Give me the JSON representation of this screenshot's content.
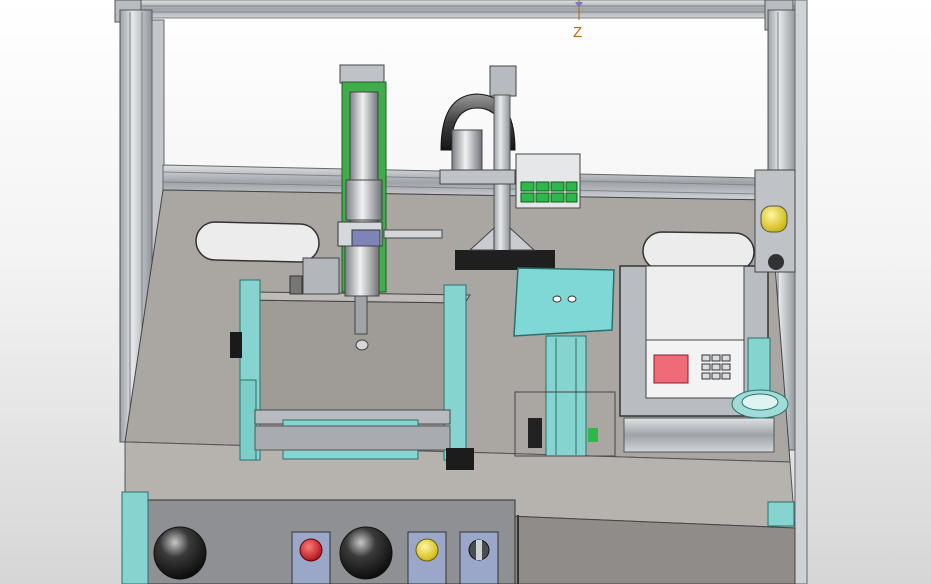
{
  "viewport": {
    "triad_axis_label": "Z"
  },
  "colors": {
    "background_top": "#ffffff",
    "background_bottom": "#d6d6d6",
    "frame_aluminium": "#c9cdd1",
    "table_plate": "#a9a6a2",
    "accent_teal": "#7fd8d6",
    "accent_green": "#2fb84a",
    "e_stop_red": "#d8242a",
    "button_yellow": "#f2dd1a",
    "scale_display_red": "#ef6b78",
    "axis_label_orange": "#b8650f"
  },
  "icons": [
    "emergency-stop-icon",
    "reset-button-icon",
    "selector-switch-icon"
  ]
}
